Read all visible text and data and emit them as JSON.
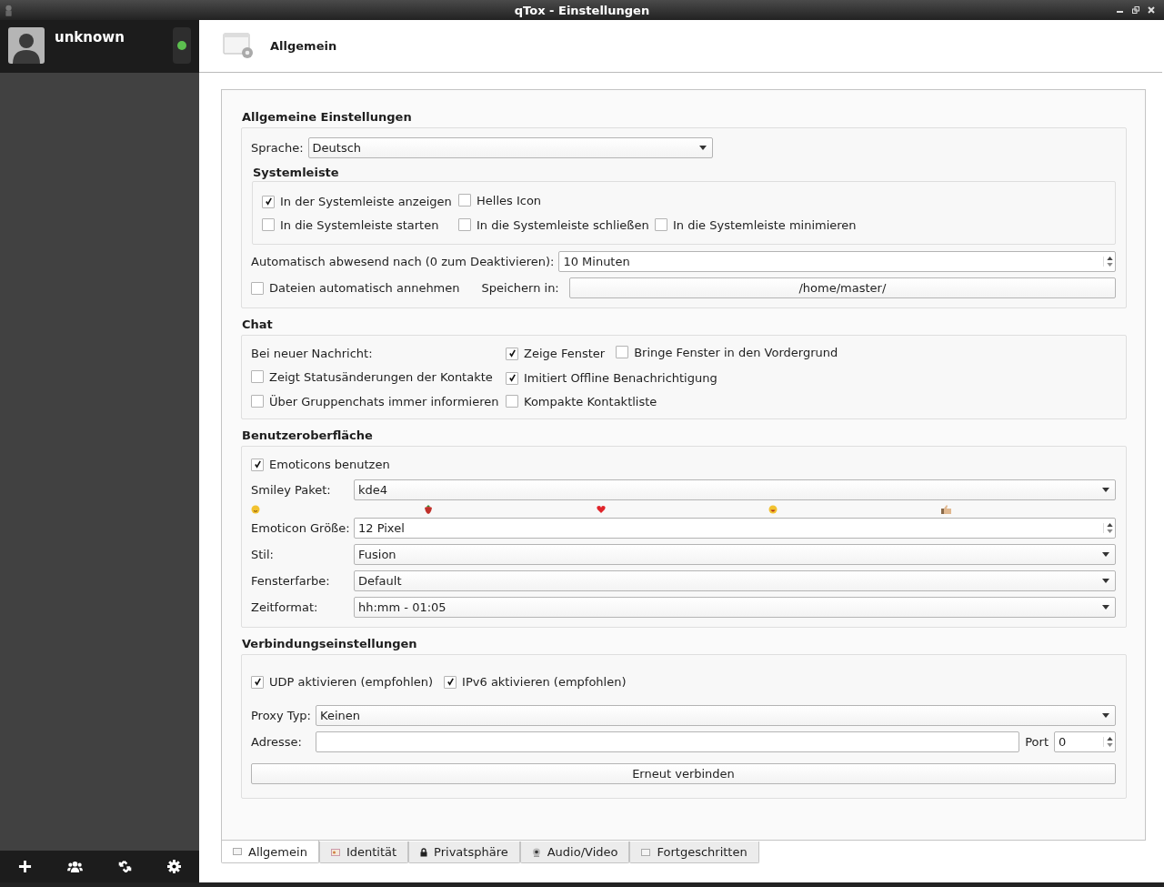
{
  "window": {
    "title": "qTox - Einstellungen"
  },
  "profile": {
    "name": "unknown",
    "online": true
  },
  "page": {
    "title": "Allgemein"
  },
  "general": {
    "title": "Allgemeine Einstellungen",
    "language": {
      "label": "Sprache:",
      "value": "Deutsch"
    },
    "tray": {
      "title": "Systemleiste",
      "rows": [
        [
          {
            "label": "In der Systemleiste anzeigen",
            "checked": true
          },
          {
            "label": "Helles Icon",
            "checked": false
          }
        ],
        [
          {
            "label": "In die Systemleiste starten",
            "checked": false
          },
          {
            "label": "In die Systemleiste schließen",
            "checked": false
          },
          {
            "label": "In die Systemleiste minimieren",
            "checked": false
          }
        ]
      ]
    },
    "away": {
      "label": "Automatisch abwesend nach (0 zum Deaktivieren):",
      "value": "10 Minuten"
    },
    "autoaccept": {
      "label": "Dateien automatisch annehmen",
      "checked": false
    },
    "save": {
      "label": "Speichern in:",
      "value": "/home/master/"
    }
  },
  "chat": {
    "title": "Chat",
    "rows": [
      [
        {
          "kind": "label",
          "label": "Bei neuer Nachricht:"
        },
        {
          "label": "Zeige Fenster",
          "checked": true
        },
        {
          "label": "Bringe Fenster in den Vordergrund",
          "checked": false
        }
      ],
      [
        {
          "label": "Zeigt Statusänderungen der Kontakte",
          "checked": false
        },
        {
          "label": "Imitiert Offline Benachrichtigung",
          "checked": true
        }
      ],
      [
        {
          "label": "Über Gruppenchats immer informieren",
          "checked": false
        },
        {
          "label": "Kompakte Kontaktliste",
          "checked": false
        }
      ]
    ]
  },
  "ui": {
    "title": "Benutzeroberfläche",
    "emoticons": {
      "label": "Emoticons benutzen",
      "checked": true
    },
    "smiley_pack": {
      "label": "Smiley Paket:",
      "value": "kde4"
    },
    "emoticon_size": {
      "label": "Emoticon Größe:",
      "value": "12 Pixel"
    },
    "combos": [
      {
        "label": "Stil:",
        "value": "Fusion"
      },
      {
        "label": "Fensterfarbe:",
        "value": "Default"
      },
      {
        "label": "Zeitformat:",
        "value": "hh:mm - 01:05"
      }
    ]
  },
  "connection": {
    "title": "Verbindungseinstellungen",
    "options": [
      {
        "label": "UDP aktivieren (empfohlen)",
        "checked": true
      },
      {
        "label": "IPv6 aktivieren (empfohlen)",
        "checked": true
      }
    ],
    "proxy_type": {
      "label": "Proxy Typ:",
      "value": "Keinen"
    },
    "address": {
      "label": "Adresse:"
    },
    "port": {
      "label": "Port",
      "value": "0"
    },
    "reconnect": "Erneut verbinden"
  },
  "tabs": [
    {
      "label": "Allgemein",
      "selected": true,
      "kind": "window"
    },
    {
      "label": "Identität",
      "selected": false,
      "kind": "identity"
    },
    {
      "label": "Privatsphäre",
      "selected": false,
      "kind": "lock"
    },
    {
      "label": "Audio/Video",
      "selected": false,
      "kind": "webcam"
    },
    {
      "label": "Fortgeschritten",
      "selected": false,
      "kind": "window"
    }
  ]
}
